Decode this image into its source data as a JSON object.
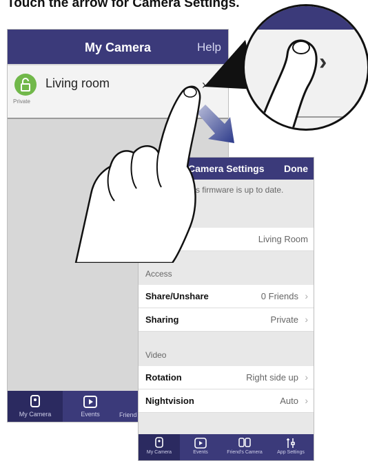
{
  "caption": "Touch the arrow for Camera Settings.",
  "back_phone": {
    "title": "My Camera",
    "help": "Help",
    "camera_name": "Living room",
    "private_label": "Private",
    "tabs": [
      {
        "label": "My Camera",
        "icon": "camera-icon"
      },
      {
        "label": "Events",
        "icon": "play-icon"
      },
      {
        "label": "Friend",
        "icon": "friends-camera-icon"
      }
    ]
  },
  "front_phone": {
    "title": "Camera Settings",
    "done": "Done",
    "firmware_text": "ra's firmware is up to date.",
    "name_value": "Living Room",
    "section_access": "Access",
    "share_label": "Share/Unshare",
    "share_value": "0 Friends",
    "sharing_label": "Sharing",
    "sharing_value": "Private",
    "section_video": "Video",
    "rotation_label": "Rotation",
    "rotation_value": "Right side up",
    "nightvision_label": "Nightvision",
    "nightvision_value": "Auto",
    "tabs": [
      {
        "label": "My Camera",
        "icon": "camera-icon"
      },
      {
        "label": "Events",
        "icon": "play-icon"
      },
      {
        "label": "Friend's Camera",
        "icon": "friends-camera-icon"
      },
      {
        "label": "App Settings",
        "icon": "tools-icon"
      }
    ]
  },
  "colors": {
    "header": "#3b3a7a",
    "private_green": "#71b84a",
    "gray_bg": "#d7d7d7"
  }
}
